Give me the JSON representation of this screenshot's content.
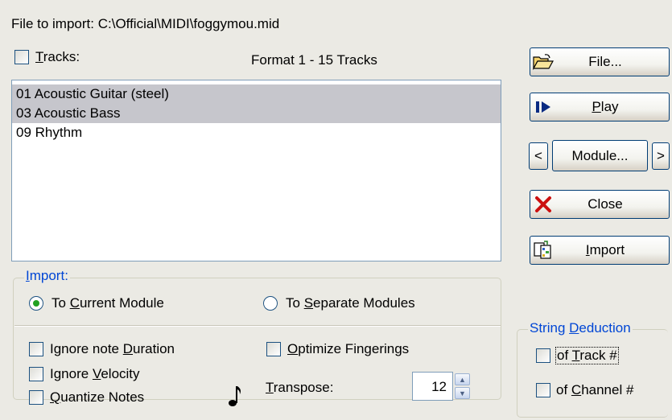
{
  "header": {
    "file_label": "File to import:",
    "file_path": "C:\\Official\\MIDI\\foggymou.mid",
    "tracks_prefix_underlined": "T",
    "tracks_rest": "racks:",
    "format_text": "Format 1 - 15 Tracks"
  },
  "tracks": {
    "items": [
      {
        "label": "01 Acoustic Guitar (steel)",
        "selected": true
      },
      {
        "label": "03 Acoustic Bass",
        "selected": true
      },
      {
        "label": "09 Rhythm",
        "selected": false
      }
    ]
  },
  "buttons": {
    "file": {
      "label": "File..."
    },
    "play": {
      "pre": "",
      "underlined": "P",
      "post": "lay"
    },
    "module": {
      "label": "Module...",
      "prev": "<",
      "next": ">"
    },
    "close": {
      "label": "Close"
    },
    "import": {
      "pre": "",
      "underlined": "I",
      "post": "mport"
    }
  },
  "import_group": {
    "title_underlined": "I",
    "title_rest": "mport:",
    "radio_current": {
      "pre": "To ",
      "underlined": "C",
      "post": "urrent Module",
      "checked": true
    },
    "radio_separate": {
      "pre": "To ",
      "underlined": "S",
      "post": "eparate Modules",
      "checked": false
    }
  },
  "options": {
    "ignore_duration": {
      "pre": "Ignore note ",
      "underlined": "D",
      "post": "uration"
    },
    "ignore_velocity": {
      "pre": "Ignore ",
      "underlined": "V",
      "post": "elocity"
    },
    "quantize": {
      "pre": "",
      "underlined": "Q",
      "post": "uantize Notes"
    },
    "optimize": {
      "pre": "",
      "underlined": "O",
      "post": "ptimize Fingerings"
    },
    "transpose_label": {
      "underlined": "T",
      "post": "ranspose:"
    },
    "transpose_value": "12"
  },
  "string_deduction": {
    "title_pre": "String ",
    "title_underlined": "D",
    "title_post": "eduction",
    "of_track": {
      "pre": "of ",
      "underlined": "T",
      "post": "rack #"
    },
    "of_channel": {
      "pre": "of ",
      "underlined": "C",
      "post": "hannel #"
    }
  },
  "colors": {
    "window_bg": "#ebeae4",
    "group_title": "#0046d5",
    "selection": "#c6c6cc",
    "radio_dot": "#21a121",
    "close_x": "#cc1010"
  }
}
